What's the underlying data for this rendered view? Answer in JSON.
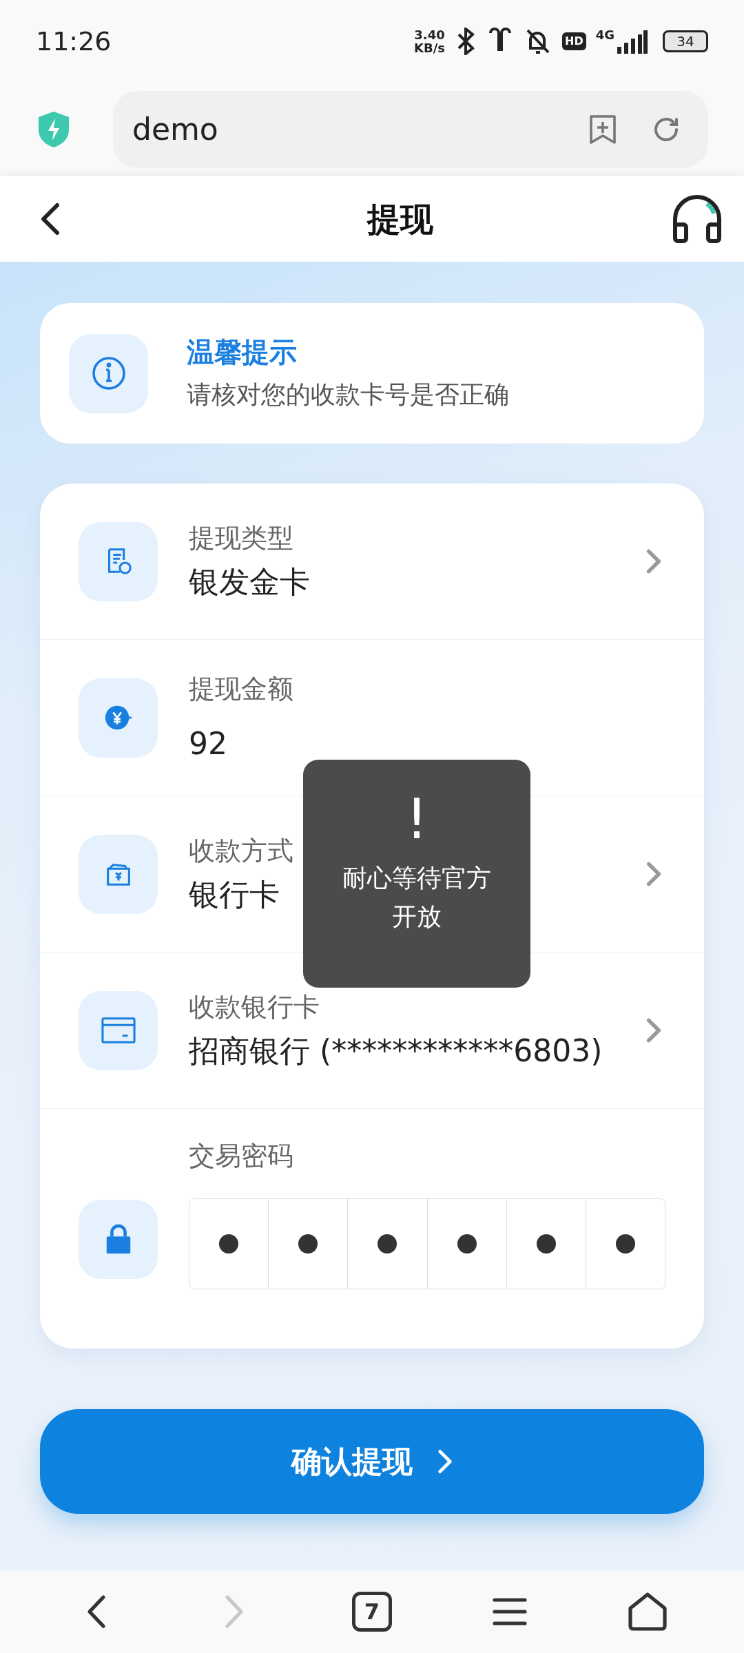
{
  "status_bar": {
    "time": "11:26",
    "net_speed": [
      "3.40",
      "KB/s"
    ],
    "hd_badge": "HD",
    "network": "4G",
    "battery": "34"
  },
  "browser": {
    "url": "demo"
  },
  "header": {
    "title": "提现"
  },
  "tip": {
    "title": "温馨提示",
    "text": "请核对您的收款卡号是否正确"
  },
  "rows": [
    {
      "kind": "select",
      "label": "提现类型",
      "value": "银发金卡"
    },
    {
      "kind": "amount",
      "label": "提现金额",
      "value": "92"
    },
    {
      "kind": "select",
      "label": "收款方式",
      "value": "银行卡"
    },
    {
      "kind": "select",
      "label": "收款银行卡",
      "value": "招商银行 (************6803)"
    },
    {
      "kind": "password",
      "label": "交易密码",
      "cells": [
        {
          "filled": true
        },
        {
          "filled": true
        },
        {
          "filled": true
        },
        {
          "filled": true
        },
        {
          "filled": true
        },
        {
          "filled": true
        }
      ]
    }
  ],
  "toast": {
    "mark": "!",
    "message": "耐心等待官方开放"
  },
  "submit": {
    "label": "确认提现"
  },
  "bottom_nav": [
    {
      "kind": "back",
      "disabled": false
    },
    {
      "kind": "forward",
      "disabled": true
    },
    {
      "kind": "tabs",
      "count": "7",
      "disabled": false
    },
    {
      "kind": "menu",
      "disabled": false
    },
    {
      "kind": "home",
      "disabled": false
    }
  ]
}
